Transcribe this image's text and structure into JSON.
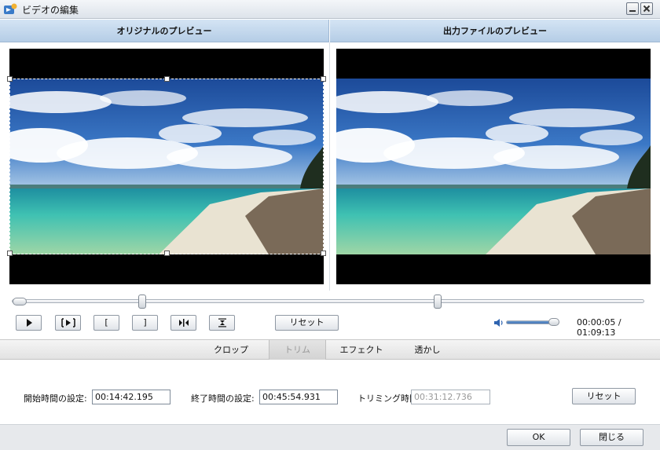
{
  "window": {
    "title": "ビデオの編集",
    "icon": "app-icon",
    "minimize_icon": "minimize-icon",
    "close_icon": "close-icon"
  },
  "preview": {
    "original_header": "オリジナルのプレビュー",
    "output_header": "出力ファイルのプレビュー"
  },
  "playback": {
    "position_fraction": 0.0,
    "trim_start_fraction": 0.2,
    "trim_end_fraction": 0.67,
    "buttons": [
      {
        "name": "play-icon"
      },
      {
        "name": "play-selection-icon"
      },
      {
        "name": "set-start-icon",
        "label": "["
      },
      {
        "name": "set-end-icon",
        "label": "]"
      },
      {
        "name": "previous-frame-icon"
      },
      {
        "name": "flip-icon"
      }
    ],
    "reset_label": "リセット",
    "volume_fraction": 0.9,
    "time": "00:00:05 / 01:09:13"
  },
  "tabs": [
    {
      "label": "クロップ",
      "active": false
    },
    {
      "label": "トリム",
      "active": true
    },
    {
      "label": "エフェクト",
      "active": false
    },
    {
      "label": "透かし",
      "active": false
    }
  ],
  "trim": {
    "start_label": "開始時間の設定:",
    "start_value": "00:14:42.195",
    "end_label": "終了時間の設定:",
    "end_value": "00:45:54.931",
    "duration_label": "トリミング時間:",
    "duration_value": "00:31:12.736",
    "reset_label": "リセット"
  },
  "footer": {
    "ok_label": "OK",
    "close_label": "閉じる"
  },
  "colors": {
    "header_blue": "#c4d8ee",
    "sky": "#2a5fb0",
    "sea": "#3cbcb0",
    "sand": "#e8e2d0"
  }
}
